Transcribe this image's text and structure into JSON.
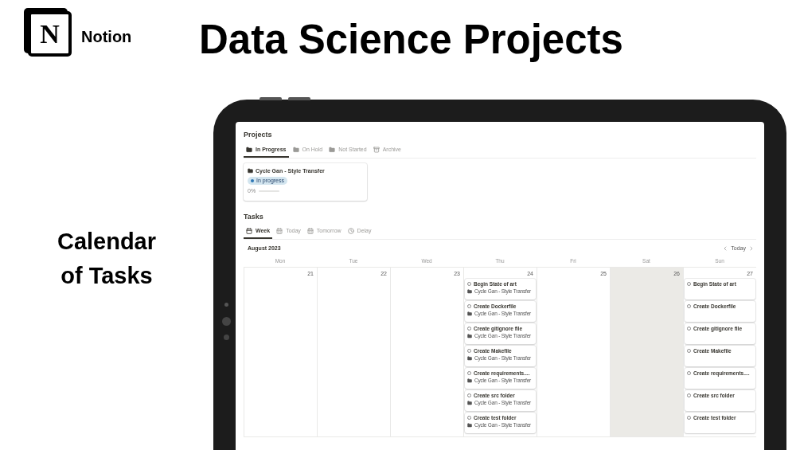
{
  "brand": {
    "logo_letter": "N",
    "name": "Notion"
  },
  "headline": "Data Science Projects",
  "side_caption": "Calendar of Tasks",
  "projects": {
    "title": "Projects",
    "tabs": [
      {
        "label": "In Progress",
        "kind": "folder",
        "selected": true
      },
      {
        "label": "On Hold",
        "kind": "folder",
        "selected": false
      },
      {
        "label": "Not Started",
        "kind": "folder",
        "selected": false
      },
      {
        "label": "Archive",
        "kind": "archive",
        "selected": false
      }
    ],
    "cards": [
      {
        "title": "Cycle Gan - Style Transfer",
        "status": "In progress",
        "progress_label": "0%",
        "level": 0
      }
    ]
  },
  "tasks": {
    "title": "Tasks",
    "tabs": [
      {
        "label": "Week",
        "kind": "calendar",
        "selected": true
      },
      {
        "label": "Today",
        "kind": "day",
        "selected": false
      },
      {
        "label": "Tomorrow",
        "kind": "day",
        "selected": false
      },
      {
        "label": "Delay",
        "kind": "clock",
        "selected": false
      }
    ],
    "calendar": {
      "month": "August 2023",
      "today_label": "Today",
      "weekdays": [
        "Mon",
        "Tue",
        "Wed",
        "Thu",
        "Fri",
        "Sat",
        "Sun"
      ],
      "days": [
        {
          "date": "21",
          "shaded": false
        },
        {
          "date": "22",
          "shaded": false
        },
        {
          "date": "23",
          "shaded": false
        },
        {
          "date": "24",
          "shaded": false,
          "events": [
            {
              "title": "Begin State of art",
              "project": "Cycle Gan - Style Transfer"
            },
            {
              "title": "Create Dockerfile",
              "project": "Cycle Gan - Style Transfer"
            },
            {
              "title": "Create gitignore file",
              "project": "Cycle Gan - Style Transfer"
            },
            {
              "title": "Create Makefile",
              "project": "Cycle Gan - Style Transfer"
            },
            {
              "title": "Create requirements....",
              "project": "Cycle Gan - Style Transfer"
            },
            {
              "title": "Create src folder",
              "project": "Cycle Gan - Style Transfer"
            },
            {
              "title": "Create test folder",
              "project": "Cycle Gan - Style Transfer"
            }
          ]
        },
        {
          "date": "25",
          "shaded": false
        },
        {
          "date": "26",
          "shaded": true
        },
        {
          "date": "27",
          "shaded": false,
          "events": [
            {
              "title": "Begin State of art"
            },
            {
              "title": "Create Dockerfile"
            },
            {
              "title": "Create gitignore file"
            },
            {
              "title": "Create Makefile"
            },
            {
              "title": "Create requirements...."
            },
            {
              "title": "Create src folder"
            },
            {
              "title": "Create test folder"
            }
          ]
        }
      ]
    }
  }
}
